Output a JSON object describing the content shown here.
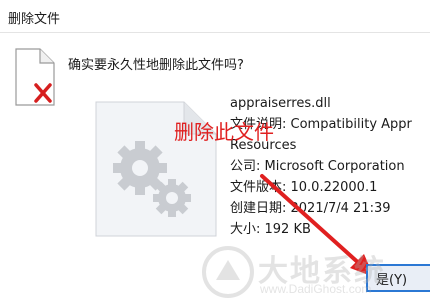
{
  "dialog": {
    "title": "删除文件",
    "question": "确实要永久性地删除此文件吗?",
    "file": {
      "name": "appraiserres.dll",
      "description": "文件说明: Compatibility Appr",
      "description_cont": "Resources",
      "company": "公司: Microsoft Corporation",
      "version": "文件版本: 10.0.22000.1",
      "created": "创建日期: 2021/7/4 21:39",
      "size": "大小: 192 KB"
    },
    "yes_button": "是(Y)"
  },
  "annotation": {
    "text": "删除此文件",
    "color": "#e02020"
  },
  "watermark": {
    "brand": "大地系统",
    "url": "www.DadiGhost.com"
  },
  "icons": [
    "file-icon",
    "delete-x-icon",
    "gear-icon",
    "red-arrow"
  ]
}
